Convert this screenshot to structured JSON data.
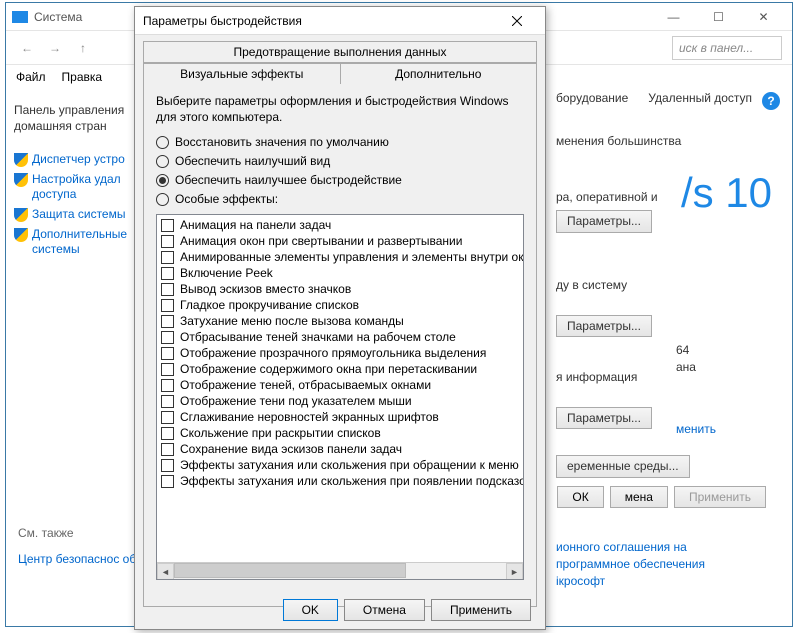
{
  "bg": {
    "title": "Система",
    "search_placeholder": "иск в панел...",
    "menu": {
      "file": "Файл",
      "edit": "Правка"
    },
    "sidebar": {
      "home": "Панель управления домашняя стран",
      "items": [
        "Диспетчер устро",
        "Настройка удал доступа",
        "Защита системы",
        "Дополнительные системы"
      ],
      "seealso": "См. также",
      "seealso_link": "Центр безопаснос обслуживания"
    },
    "tabs": {
      "hw": "борудование",
      "remote": "Удаленный доступ"
    },
    "content": {
      "admin": "менения большинства",
      "ram": "ра, оперативной и",
      "params": "Параметры...",
      "login": "ду в систему",
      "x64": "64",
      "ana": "ана",
      "info": "я информация",
      "change": "менить",
      "env": "еременные среды...",
      "lic1": "ионного соглашения на",
      "lic2": "программное обеспечения",
      "lic3": "ікрософт"
    },
    "btns": {
      "ok": "ОК",
      "cancel": "мена",
      "apply": "Применить"
    },
    "win10": "/s 10"
  },
  "dialog": {
    "title": "Параметры быстродействия",
    "tabs": {
      "dep": "Предотвращение выполнения данных",
      "vis": "Визуальные эффекты",
      "adv": "Дополнительно"
    },
    "desc": "Выберите параметры оформления и быстродействия Windows для этого компьютера.",
    "radios": [
      "Восстановить значения по умолчанию",
      "Обеспечить наилучший вид",
      "Обеспечить наилучшее быстродействие",
      "Особые эффекты:"
    ],
    "selected_radio": 2,
    "effects": [
      "Анимация на панели задач",
      "Анимация окон при свертывании и развертывании",
      "Анимированные элементы управления и элементы внутри окн",
      "Включение Peek",
      "Вывод эскизов вместо значков",
      "Гладкое прокручивание списков",
      "Затухание меню после вызова команды",
      "Отбрасывание теней значками на рабочем столе",
      "Отображение прозрачного прямоугольника выделения",
      "Отображение содержимого окна при перетаскивании",
      "Отображение теней, отбрасываемых окнами",
      "Отображение тени под указателем мыши",
      "Сглаживание неровностей экранных шрифтов",
      "Скольжение при раскрытии списков",
      "Сохранение вида эскизов панели задач",
      "Эффекты затухания или скольжения при обращении к меню",
      "Эффекты затухания или скольжения при появлении подсказок"
    ],
    "buttons": {
      "ok": "OK",
      "cancel": "Отмена",
      "apply": "Применить"
    }
  }
}
